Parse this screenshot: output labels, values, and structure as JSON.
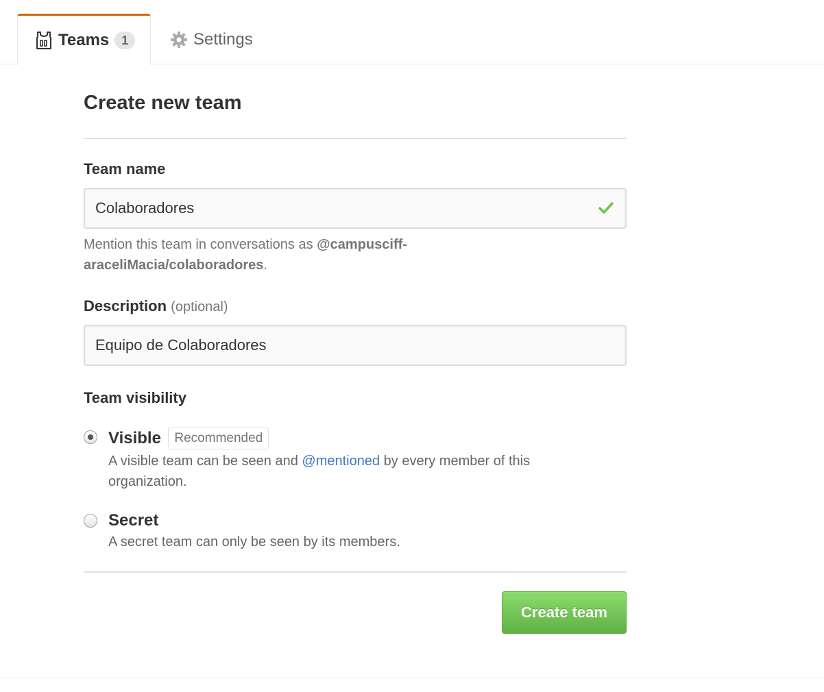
{
  "tabs": {
    "teams": {
      "label": "Teams",
      "count": "1",
      "icon": "jersey-icon"
    },
    "settings": {
      "label": "Settings",
      "icon": "gear-icon"
    }
  },
  "form": {
    "title": "Create new team",
    "team_name": {
      "label": "Team name",
      "value": "Colaboradores",
      "valid_icon": "check-icon",
      "valid_color": "#6cc644"
    },
    "mention_note": {
      "prefix": "Mention this team in conversations as ",
      "handle": "@campusciff-araceliMacia/colaboradores",
      "suffix": "."
    },
    "description": {
      "label": "Description",
      "optional": "(optional)",
      "value": "Equipo de Colaboradores"
    },
    "visibility": {
      "label": "Team visibility",
      "visible": {
        "title": "Visible",
        "badge": "Recommended",
        "desc_before": "A visible team can be seen and ",
        "desc_link": "@mentioned",
        "desc_after": " by every member of this organization.",
        "selected": true
      },
      "secret": {
        "title": "Secret",
        "desc": "A secret team can only be seen by its members.",
        "selected": false
      }
    },
    "submit_label": "Create team"
  },
  "colors": {
    "tab_accent": "#d26911",
    "button_green": "#6cc644",
    "link_blue": "#4078c0"
  }
}
